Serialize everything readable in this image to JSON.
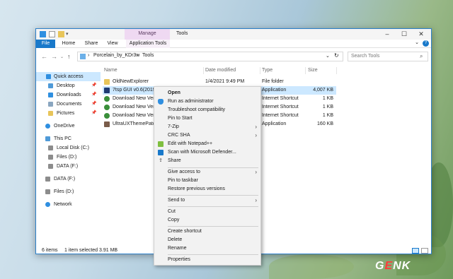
{
  "window": {
    "contextual_tab": "Manage",
    "title": "Tools",
    "tabs": [
      "File",
      "Home",
      "Share",
      "View",
      "Application Tools"
    ]
  },
  "address": {
    "breadcrumb": [
      "Porcelain_by_KDr3w",
      "Tools"
    ],
    "search_placeholder": "Search Tools"
  },
  "sidebar": {
    "items": [
      {
        "label": "Quick access",
        "icon": "star-icon"
      },
      {
        "label": "Desktop",
        "icon": "desktop-icon"
      },
      {
        "label": "Downloads",
        "icon": "downloads-icon"
      },
      {
        "label": "Documents",
        "icon": "documents-icon"
      },
      {
        "label": "Pictures",
        "icon": "pictures-icon"
      },
      {
        "label": "OneDrive",
        "icon": "cloud-icon"
      },
      {
        "label": "This PC",
        "icon": "computer-icon"
      },
      {
        "label": "Local Disk (C:)",
        "icon": "drive-icon"
      },
      {
        "label": "Files (D:)",
        "icon": "drive-icon"
      },
      {
        "label": "DATA (F:)",
        "icon": "drive-icon"
      },
      {
        "label": "DATA (F:)",
        "icon": "drive-icon"
      },
      {
        "label": "Files (D:)",
        "icon": "drive-icon"
      },
      {
        "label": "Network",
        "icon": "network-icon"
      }
    ]
  },
  "columns": [
    "Name",
    "Date modified",
    "Type",
    "Size"
  ],
  "files": [
    {
      "name": "OldNewExplorer",
      "date": "1/4/2021 9:49 PM",
      "type": "File folder",
      "size": "",
      "icon": "folder-icon",
      "color": "#e8c55a"
    },
    {
      "name": "7tsp GUI v0.6(2019).e",
      "date": "",
      "type": "Application",
      "size": "4,007 KB",
      "icon": "7tsp-app-icon",
      "color": "#1f3b73"
    },
    {
      "name": "Download New Versi",
      "date": "",
      "type": "Internet Shortcut",
      "size": "1 KB",
      "icon": "chrome-icon",
      "color": "#3a8f3a"
    },
    {
      "name": "Download New Versi",
      "date": "",
      "type": "Internet Shortcut",
      "size": "1 KB",
      "icon": "chrome-icon",
      "color": "#3a8f3a"
    },
    {
      "name": "Download New Versi",
      "date": "",
      "type": "Internet Shortcut",
      "size": "1 KB",
      "icon": "chrome-icon",
      "color": "#3a8f3a"
    },
    {
      "name": "UltraUXThemePatch",
      "date": "",
      "type": "Application",
      "size": "160 KB",
      "icon": "app-icon",
      "color": "#7a5c4a"
    }
  ],
  "status": {
    "items": "6 items",
    "selected": "1 item selected  3.91 MB"
  },
  "context_menu": {
    "items": [
      {
        "label": "Open",
        "bold": true
      },
      {
        "label": "Run as administrator",
        "icon": "shield-icon"
      },
      {
        "label": "Troubleshoot compatibility"
      },
      {
        "label": "Pin to Start"
      },
      {
        "label": "7-Zip",
        "submenu": true
      },
      {
        "label": "CRC SHA",
        "submenu": true
      },
      {
        "label": "Edit with Notepad++",
        "icon": "notepadpp-icon"
      },
      {
        "label": "Scan with Microsoft Defender...",
        "icon": "defender-icon"
      },
      {
        "label": "Share",
        "icon": "share-icon"
      },
      {
        "label": "Give access to",
        "submenu": true
      },
      {
        "label": "Pin to taskbar"
      },
      {
        "label": "Restore previous versions"
      },
      {
        "label": "Send to",
        "submenu": true
      },
      {
        "label": "Cut"
      },
      {
        "label": "Copy"
      },
      {
        "label": "Create shortcut"
      },
      {
        "label": "Delete"
      },
      {
        "label": "Rename"
      },
      {
        "label": "Properties"
      }
    ]
  },
  "watermark": "GENK"
}
